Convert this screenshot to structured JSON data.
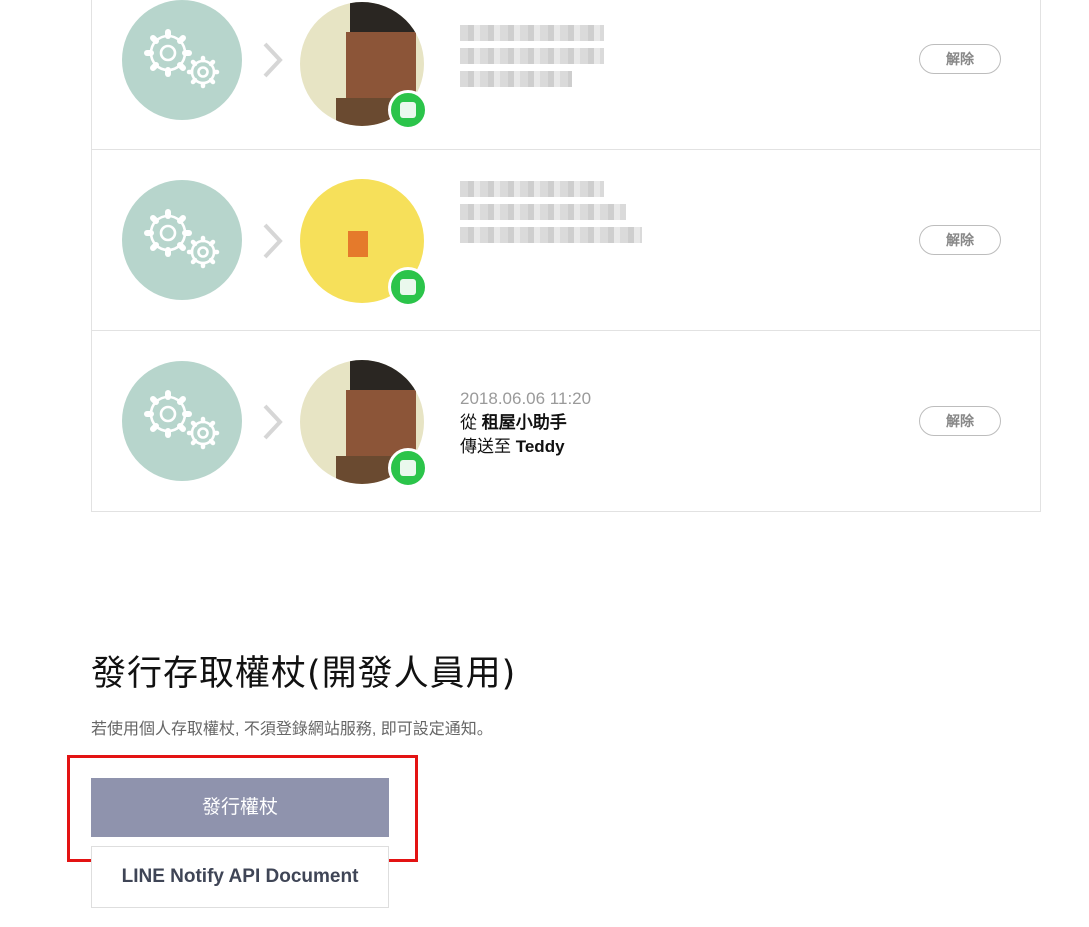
{
  "colors": {
    "gear_circle": "#b7d5cc",
    "issue_button_bg": "#8f93ad",
    "highlight_border": "#e31313",
    "badge_green": "#2bc44a"
  },
  "connections": [
    {
      "service_icon": "gears-icon",
      "avatar": "person-avatar-blurred",
      "details_blurred": true,
      "release_label": "解除"
    },
    {
      "service_icon": "gears-icon",
      "avatar": "yellow-avatar-blurred",
      "details_blurred": true,
      "release_label": "解除"
    },
    {
      "service_icon": "gears-icon",
      "avatar": "person-avatar-blurred",
      "details_blurred": false,
      "date": "2018.06.06 11:20",
      "from_prefix": "從",
      "from_name": "租屋小助手",
      "to_prefix": "傳送至",
      "to_name": "Teddy",
      "release_label": "解除"
    }
  ],
  "token_section": {
    "title": "發行存取權杖(開發人員用)",
    "description": "若使用個人存取權杖, 不須登錄網站服務, 即可設定通知。",
    "issue_button_label": "發行權杖",
    "doc_button_label": "LINE Notify API Document"
  }
}
